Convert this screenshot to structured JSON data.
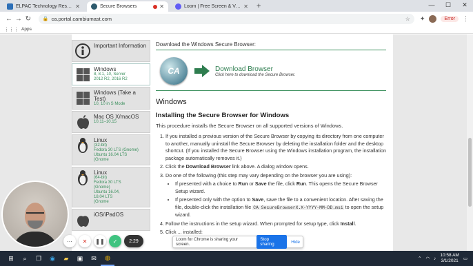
{
  "tabs": [
    {
      "title": "ELPAC Technology Resources",
      "active": false,
      "favicon_color": "#2d6fb7"
    },
    {
      "title": "Secure Browsers",
      "active": true,
      "favicon_color": "#2d5a6d"
    },
    {
      "title": "Loom | Free Screen & Video Re...",
      "active": false,
      "favicon_color": "#625df5"
    }
  ],
  "new_tab_label": "+",
  "url": "ca.portal.cambiumast.com",
  "bookmarks_label": "Apps",
  "error_label": "Error",
  "sidebar": {
    "items": [
      {
        "title": "Important Information",
        "sub": "",
        "icon": "info-icon"
      },
      {
        "title": "Windows",
        "sub": "8, 8.1, 10, Server\n2012 R2, 2016 R2",
        "icon": "windows-icon"
      },
      {
        "title": "Windows (Take a Test)",
        "sub": "10, 10 in S Mode",
        "icon": "windows-icon"
      },
      {
        "title": "Mac OS X/macOS",
        "sub": "10.11–10.15",
        "icon": "apple-icon"
      },
      {
        "title": "Linux",
        "sub": "(32-bit)\nFedora 30 LTS (Gnome)\nUbuntu 16.04 LTS\n(Gnome",
        "icon": "linux-icon"
      },
      {
        "title": "Linux",
        "sub": "(64-bit)\nFedora 30 LTS\n(Gnome)\nUbuntu 16.04,\n18.04 LTS\n(Gnome",
        "icon": "linux-icon"
      },
      {
        "title": "iOS/iPadOS",
        "sub": "",
        "icon": "apple-icon"
      }
    ]
  },
  "main": {
    "download_header": "Download the Windows Secure Browser:",
    "logo_text": "CA",
    "download_link": "Download Browser",
    "download_hint": "Click here to download the Secure Browser.",
    "section_title": "Windows",
    "install_title": "Installing the Secure Browser for Windows",
    "intro": "This procedure installs the Secure Browser on all supported versions of Windows.",
    "step1": "If you installed a previous version of the Secure Browser by copying its directory from one computer to another, manually uninstall the Secure Browser by deleting the installation folder and the desktop shortcut. (If you installed the Secure Browser using the Windows installation program, the installation package automatically removes it.)",
    "step2_pre": "Click the ",
    "step2_bold": "Download Browser",
    "step2_post": " link above. A dialog window opens.",
    "step3": "Do one of the following (this step may vary depending on the browser you are using):",
    "step3a_pre": "If presented with a choice to ",
    "step3a_run": "Run",
    "step3a_or": " or ",
    "step3a_save": "Save",
    "step3a_mid": " the file, click ",
    "step3a_run2": "Run",
    "step3a_post": ". This opens the Secure Browser Setup wizard.",
    "step3b_pre": "If presented only with the option to ",
    "step3b_save": "Save",
    "step3b_mid": ", save the file to a convenient location. After saving the file, double-click the installation file ",
    "step3b_code": "CA SecureBrowserX.X-YYYY-MM-DD.msi",
    "step3b_post": " to open the setup wizard.",
    "step4_pre": "Follow the instructions in the setup wizard. When prompted for setup type, click ",
    "step4_bold": "Install",
    "step4_post": ".",
    "step5": "Click ... installed:"
  },
  "loom": {
    "timer": "2:29",
    "share_text": "Loom for Chrome is sharing your screen.",
    "stop_label": "Stop sharing",
    "hide_label": "Hide"
  },
  "taskbar": {
    "time": "10:58 AM",
    "date": "3/1/2021"
  }
}
